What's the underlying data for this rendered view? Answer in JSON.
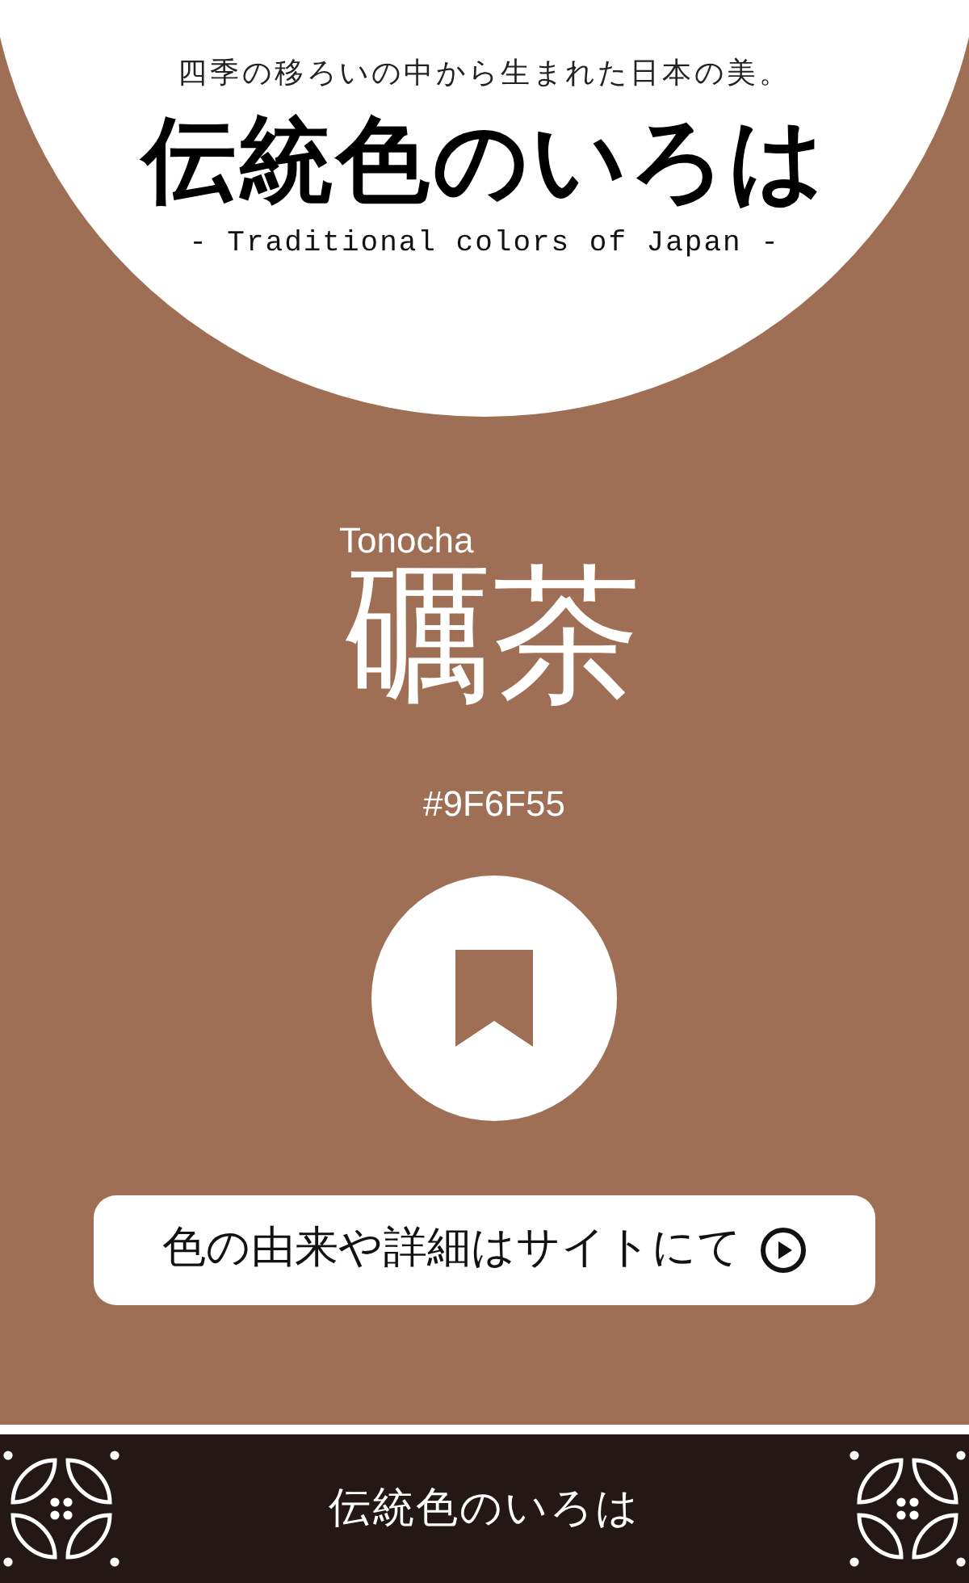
{
  "header": {
    "tagline": "四季の移ろいの中から生まれた日本の美。",
    "logo": "伝統色のいろは",
    "subtitle": "- Traditional colors of Japan -"
  },
  "color": {
    "romaji": "Tonocha",
    "name": "礪茶",
    "hex": "#9F6F55"
  },
  "link_button": {
    "label": "色の由来や詳細はサイトにて"
  },
  "footer": {
    "title": "伝統色のいろは"
  }
}
